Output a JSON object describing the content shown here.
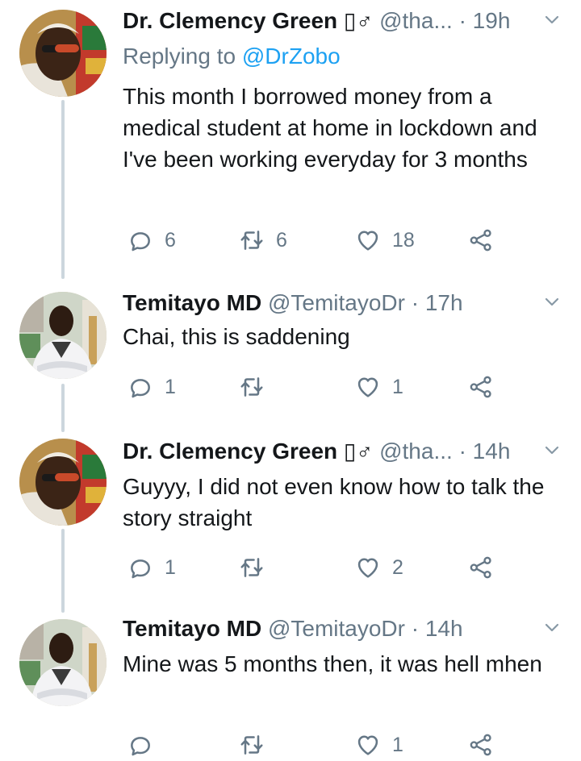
{
  "tweets": [
    {
      "name": "Dr. Clemency Green ▯♂",
      "handle": "@tha...",
      "dot": "·",
      "time": "19h",
      "replying_prefix": "Replying to ",
      "replying_to": "@DrZobo",
      "text": "This month I borrowed money from a medical student at home in lockdown and I've been working everyday for 3 months",
      "replies": "6",
      "retweets": "6",
      "likes": "18"
    },
    {
      "name": "Temitayo MD",
      "handle": "@TemitayoDr",
      "dot": "·",
      "time": "17h",
      "text": "Chai, this is saddening",
      "replies": "1",
      "retweets": "",
      "likes": "1"
    },
    {
      "name": "Dr. Clemency Green ▯♂",
      "handle": "@tha...",
      "dot": "·",
      "time": "14h",
      "text": "Guyyy, I did not even know how to talk the story straight",
      "replies": "1",
      "retweets": "",
      "likes": "2"
    },
    {
      "name": "Temitayo MD",
      "handle": "@TemitayoDr",
      "dot": "·",
      "time": "14h",
      "text": "Mine was 5 months then, it was hell mhen",
      "replies": "",
      "retweets": "",
      "likes": "1"
    }
  ],
  "colors": {
    "text": "#14171a",
    "secondary": "#657786",
    "link": "#1da1f2",
    "thread_line": "#ccd6dd"
  },
  "icons": [
    "reply-icon",
    "retweet-icon",
    "like-icon",
    "share-icon",
    "chevron-down-icon"
  ]
}
